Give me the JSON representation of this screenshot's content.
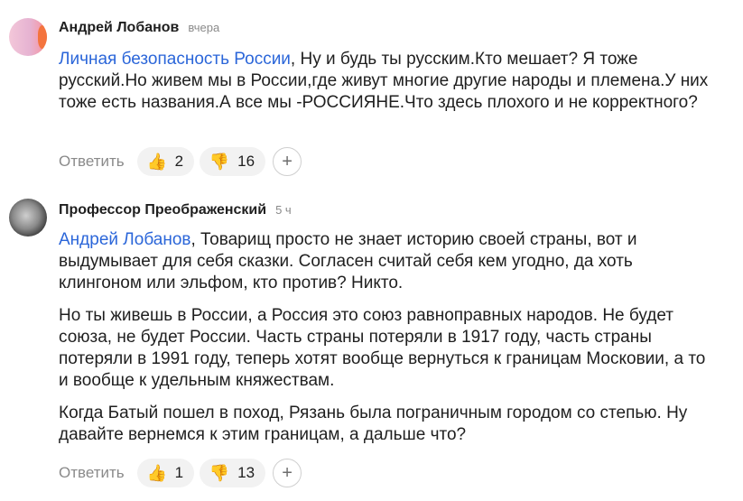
{
  "comments": [
    {
      "author": "Андрей Лобанов",
      "time": "вчера",
      "mention": "Личная безопасность России",
      "text_after_mention": ", Ну и будь ты русским.Кто мешает? Я тоже русский.Но живем мы в России,где живут многие другие народы и племена.У них тоже есть названия.А все мы -РОССИЯНЕ.Что здесь плохого и не корректного?",
      "reply_label": "Ответить",
      "likes": "2",
      "dislikes": "16",
      "add_symbol": "+"
    },
    {
      "author": "Профессор Преображенский",
      "time": "5 ч",
      "mention": "Андрей Лобанов",
      "text_after_mention": ", Товарищ просто не знает историю своей страны, вот и выдумывает для себя сказки. Согласен считай себя кем угодно, да хоть клингоном или эльфом, кто против? Никто.",
      "paragraph2": "Но ты живешь в России, а Россия это союз равноправных народов. Не будет союза, не будет России. Часть страны потеряли в 1917 году, часть страны потеряли в 1991 году, теперь хотят вообще вернуться к границам Московии, а то и вообще к удельным княжествам.",
      "paragraph3": "Когда Батый пошел в поход, Рязань была пограничным городом со степью. Ну давайте вернемся к этим границам, а дальше что?",
      "reply_label": "Ответить",
      "likes": "1",
      "dislikes": "13",
      "add_symbol": "+"
    }
  ],
  "icons": {
    "like": "thumbs-up-icon",
    "dislike": "thumbs-down-icon",
    "add": "plus-icon"
  },
  "colors": {
    "mention": "#2b66d9",
    "muted": "#8a8a8a",
    "pill_bg": "#f2f2f2",
    "thumb": "#f2a11d"
  }
}
